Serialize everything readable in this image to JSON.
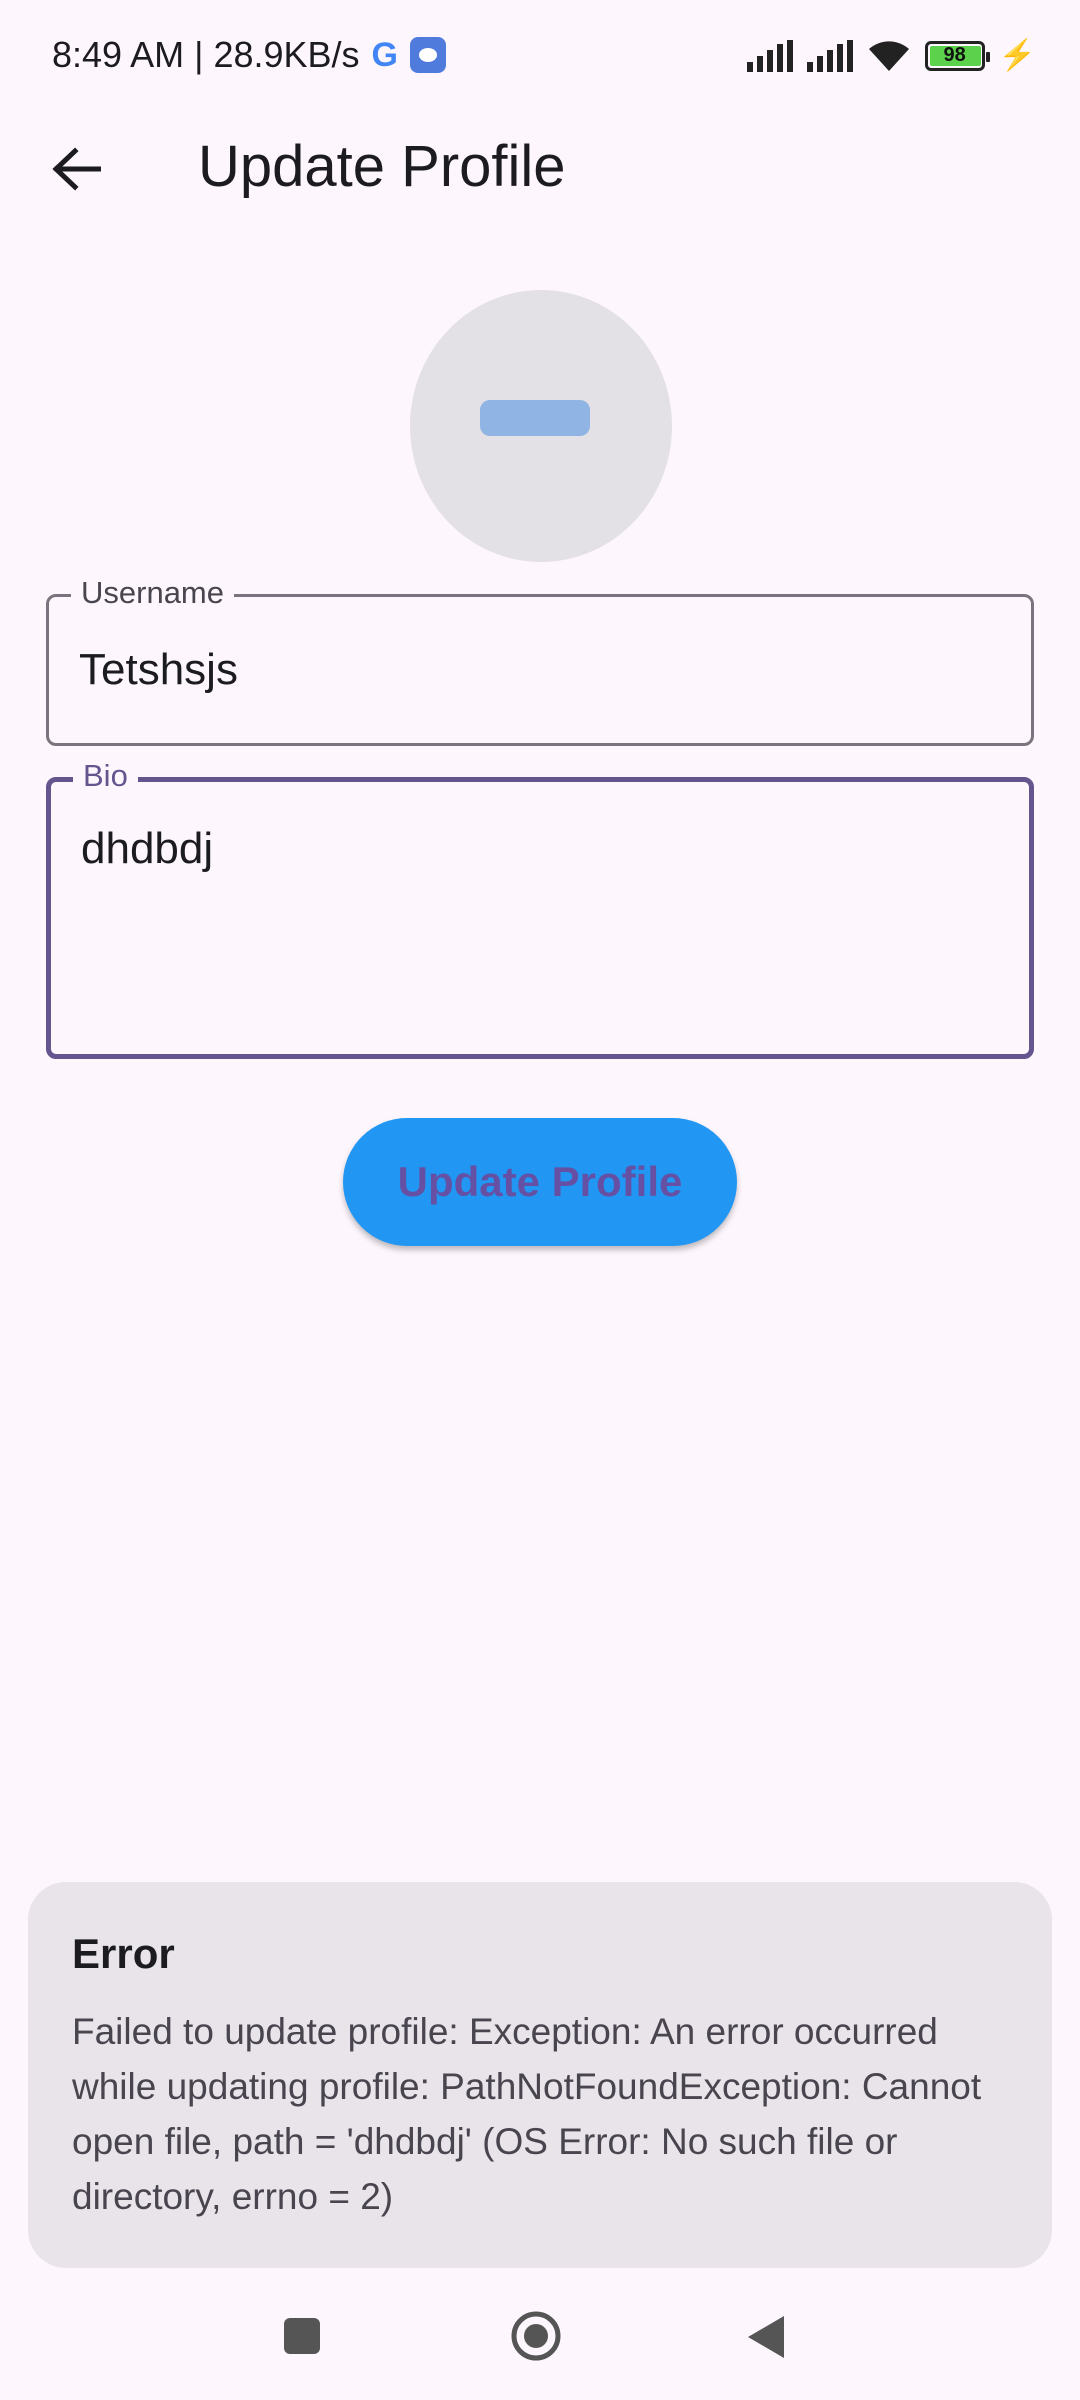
{
  "status_bar": {
    "time_speed": "8:49 AM | 28.9KB/s",
    "battery": "98",
    "icons": [
      "google-icon",
      "app-notification-icon",
      "signal-icon",
      "signal-icon",
      "wifi-icon",
      "battery-icon",
      "charging-icon"
    ]
  },
  "app_bar": {
    "title": "Update Profile",
    "back_icon": "arrow-back-icon"
  },
  "form": {
    "username_label": "Username",
    "username_value": "Tetshsjs",
    "bio_label": "Bio",
    "bio_value": "dhdbdj",
    "submit_label": "Update Profile"
  },
  "error": {
    "title": "Error",
    "message": "Failed to update profile: Exception: An error occurred while updating profile: PathNotFoundException: Cannot open file, path = 'dhdbdj' (OS Error: No such file or directory, errno = 2)"
  },
  "colors": {
    "background": "#fdf7fd",
    "accent": "#65558f",
    "button": "#2196f3",
    "error_card": "#e8e4ea"
  }
}
